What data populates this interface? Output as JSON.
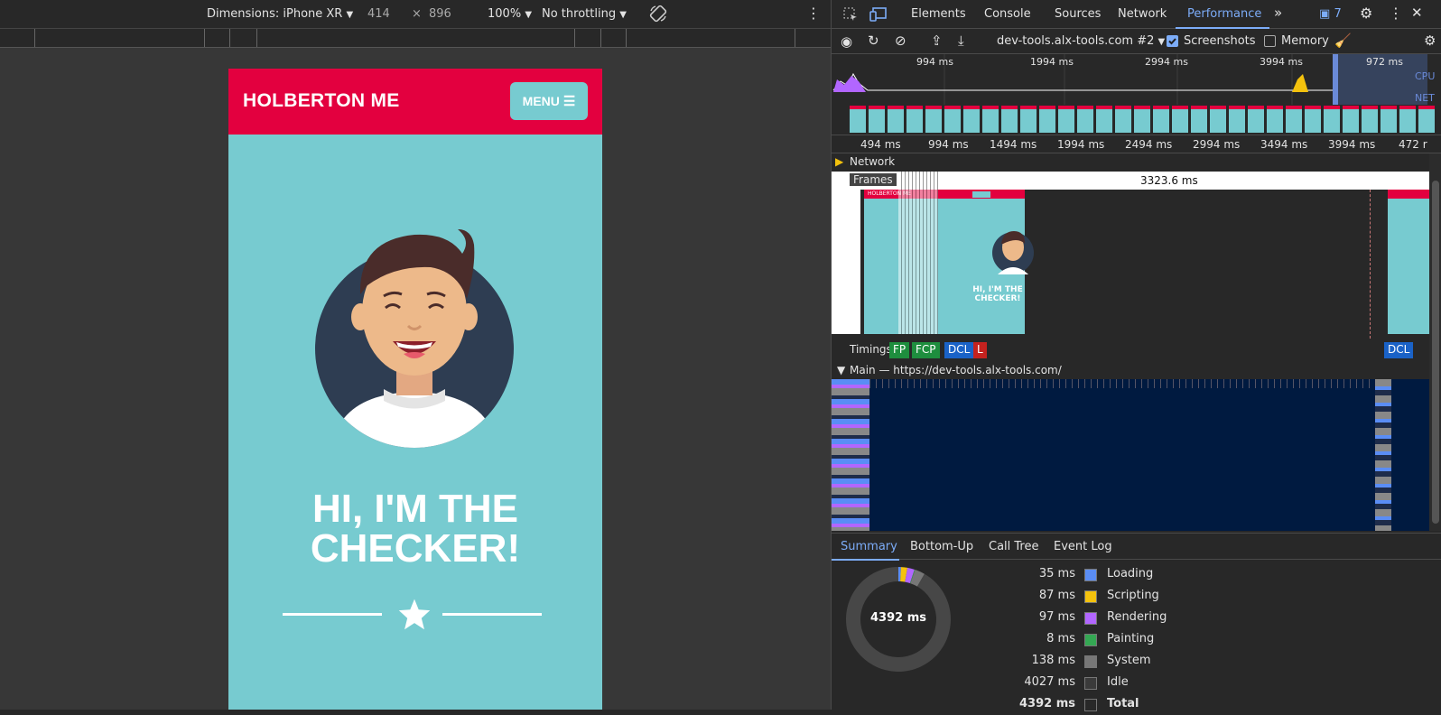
{
  "device_toolbar": {
    "dimensions_label": "Dimensions: iPhone XR",
    "width": "414",
    "times": "×",
    "height": "896",
    "zoom": "100%",
    "throttling": "No throttling"
  },
  "page": {
    "brand": "HOLBERTON ME",
    "menu_label": "MENU",
    "hero_line1": "HI, I'M THE",
    "hero_line2": "CHECKER!"
  },
  "devtools": {
    "tabs": [
      "Elements",
      "Console",
      "Sources",
      "Network",
      "Performance"
    ],
    "issues_count": "7",
    "recording_target": "dev-tools.alx-tools.com #2",
    "screenshots_label": "Screenshots",
    "memory_label": "Memory",
    "overview_ticks": [
      "994 ms",
      "1994 ms",
      "2994 ms",
      "3994 ms",
      "972 ms"
    ],
    "overview_labels": [
      "CPU",
      "NET"
    ],
    "ruler_ticks": [
      "494 ms",
      "994 ms",
      "1494 ms",
      "1994 ms",
      "2494 ms",
      "2994 ms",
      "3494 ms",
      "3994 ms",
      "472 r"
    ],
    "network_label": "Network",
    "frames_label": "Frames",
    "frame_duration": "3323.6 ms",
    "timings_label": "Timings",
    "timing_badges": [
      "FP",
      "FCP",
      "DCL",
      "L",
      "DCL"
    ],
    "main_label": "Main — https://dev-tools.alx-tools.com/",
    "thumb_brand": "HOLBERTON ME",
    "thumb_hero": "HI, I'M THE CHECKER!",
    "summary_tabs": [
      "Summary",
      "Bottom-Up",
      "Call Tree",
      "Event Log"
    ],
    "summary_total": "4392 ms",
    "summary_rows": [
      {
        "value": "35 ms",
        "label": "Loading",
        "color": "#5a8df5"
      },
      {
        "value": "87 ms",
        "label": "Scripting",
        "color": "#f4c20d"
      },
      {
        "value": "97 ms",
        "label": "Rendering",
        "color": "#b266ff"
      },
      {
        "value": "8 ms",
        "label": "Painting",
        "color": "#34a853"
      },
      {
        "value": "138 ms",
        "label": "System",
        "color": "#777777"
      },
      {
        "value": "4027 ms",
        "label": "Idle",
        "color": "#3a3a3a"
      },
      {
        "value": "4392 ms",
        "label": "Total",
        "color": "#282828"
      }
    ]
  }
}
